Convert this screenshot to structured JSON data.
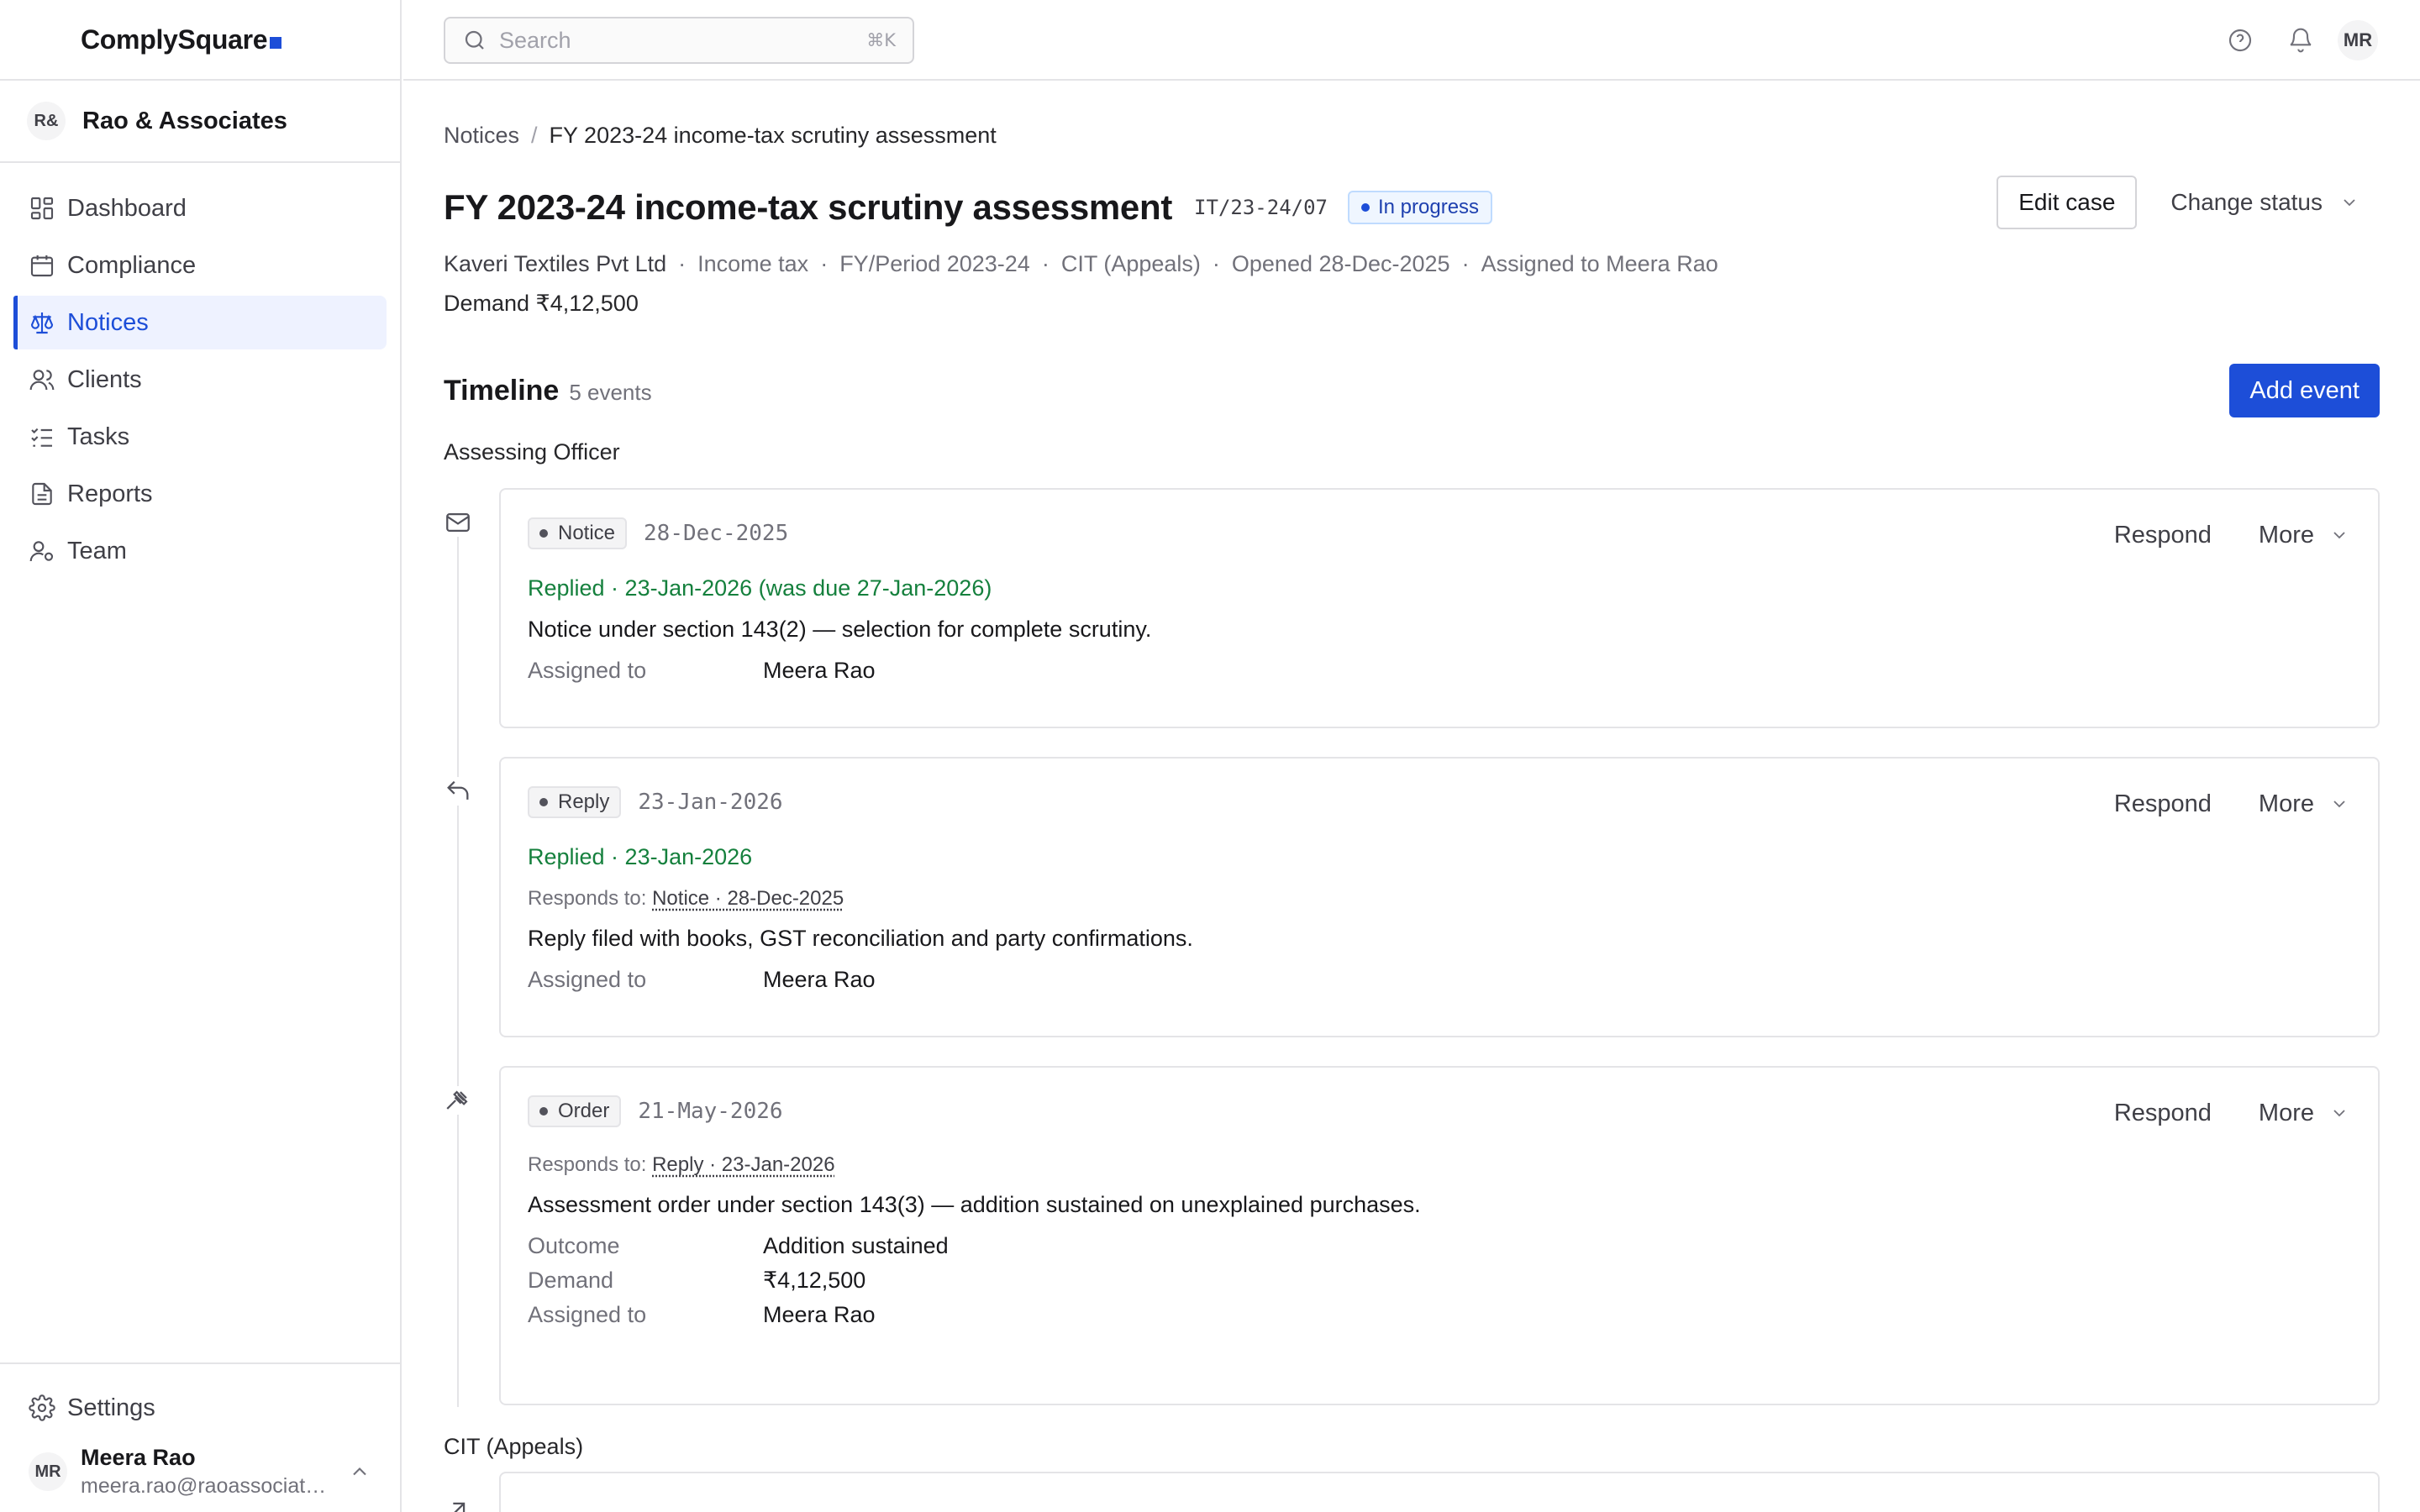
{
  "app": {
    "name": "ComplySquare",
    "org": {
      "initials": "R&",
      "name": "Rao & Associates"
    }
  },
  "nav": {
    "items": [
      {
        "label": "Dashboard",
        "icon": "dashboard-icon"
      },
      {
        "label": "Compliance",
        "icon": "calendar-icon"
      },
      {
        "label": "Notices",
        "icon": "scale-icon",
        "active": true
      },
      {
        "label": "Clients",
        "icon": "users-icon"
      },
      {
        "label": "Tasks",
        "icon": "list-checks-icon"
      },
      {
        "label": "Reports",
        "icon": "file-text-icon"
      },
      {
        "label": "Team",
        "icon": "user-cog-icon"
      }
    ],
    "settings_label": "Settings"
  },
  "user": {
    "initials": "MR",
    "name": "Meera Rao",
    "email": "meera.rao@raoassociates.in"
  },
  "topbar": {
    "search_placeholder": "Search",
    "search_shortcut": "⌘K",
    "avatar_initials": "MR"
  },
  "breadcrumb": {
    "parent": "Notices",
    "separator": "/",
    "current": "FY 2023-24 income-tax scrutiny assessment"
  },
  "case": {
    "title": "FY 2023-24 income-tax scrutiny assessment",
    "code": "IT/23-24/07",
    "status": "In progress",
    "client": "Kaveri Textiles Pvt Ltd",
    "type": "Income tax",
    "period": "FY/Period 2023-24",
    "forum": "CIT (Appeals)",
    "opened": "Opened 28-Dec-2025",
    "assigned": "Assigned to Meera Rao",
    "demand": "Demand ₹4,12,500",
    "edit_label": "Edit case",
    "change_status_label": "Change status"
  },
  "timeline": {
    "title": "Timeline",
    "count": "5 events",
    "add_label": "Add event",
    "groups": [
      {
        "label": "Assessing Officer"
      },
      {
        "label": "CIT (Appeals)"
      }
    ],
    "events": [
      {
        "type": "Notice",
        "icon": "mail-icon",
        "date": "28-Dec-2025",
        "replied": "Replied · 23-Jan-2026 (was due 27-Jan-2026)",
        "description": "Notice under section 143(2) — selection for complete scrutiny.",
        "assigned_label": "Assigned to",
        "assigned_value": "Meera Rao"
      },
      {
        "type": "Reply",
        "icon": "reply-icon",
        "date": "23-Jan-2026",
        "replied": "Replied · 23-Jan-2026",
        "responds_label": "Responds to:",
        "responds_link": "Notice · 28-Dec-2025",
        "description": "Reply filed with books, GST reconciliation and party confirmations.",
        "assigned_label": "Assigned to",
        "assigned_value": "Meera Rao"
      },
      {
        "type": "Order",
        "icon": "gavel-icon",
        "date": "21-May-2026",
        "responds_label": "Responds to:",
        "responds_link": "Reply · 23-Jan-2026",
        "description": "Assessment order under section 143(3) — addition sustained on unexplained purchases.",
        "outcome_label": "Outcome",
        "outcome_value": "Addition sustained",
        "demand_label": "Demand",
        "demand_value": "₹4,12,500",
        "assigned_label": "Assigned to",
        "assigned_value": "Meera Rao"
      }
    ],
    "respond_label": "Respond",
    "more_label": "More"
  },
  "colors": {
    "accent": "#1d4ed8",
    "success": "#15803d",
    "border": "#e4e4e7"
  }
}
